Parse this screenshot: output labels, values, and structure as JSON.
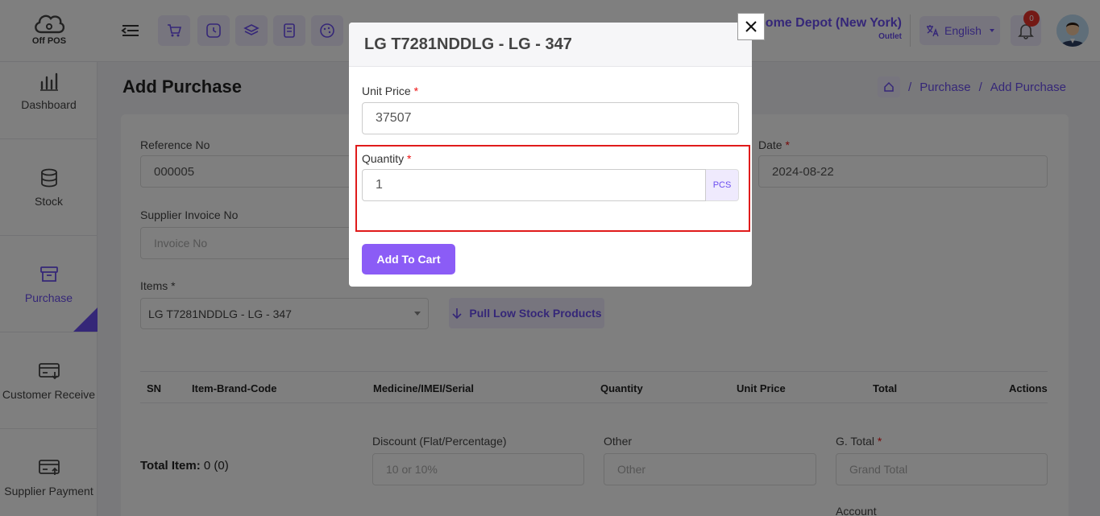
{
  "app": {
    "logo_text": "Off POS"
  },
  "header": {
    "outlet_name": "Home Depot (New York)",
    "outlet_sub": "Outlet",
    "language": "English",
    "notification_count": "0"
  },
  "sidebar": {
    "items": [
      {
        "label": "Dashboard",
        "icon": "bar-chart-icon"
      },
      {
        "label": "Stock",
        "icon": "database-icon"
      },
      {
        "label": "Purchase",
        "icon": "archive-box-icon"
      },
      {
        "label": "Customer Receive",
        "icon": "card-receive-icon"
      },
      {
        "label": "Supplier Payment",
        "icon": "card-pay-icon"
      }
    ]
  },
  "page": {
    "title": "Add Purchase",
    "breadcrumb": [
      "Purchase",
      "Add Purchase"
    ]
  },
  "form": {
    "reference_label": "Reference No",
    "reference_value": "000005",
    "date_label": "Date",
    "date_value": "2024-08-22",
    "supplier_invoice_label": "Supplier Invoice No",
    "supplier_invoice_placeholder": "Invoice No",
    "items_label": "Items *",
    "items_value": "LG T7281NDDLG - LG - 347",
    "pull_button": "Pull Low Stock Products",
    "table_headers": [
      "SN",
      "Item-Brand-Code",
      "Medicine/IMEI/Serial",
      "Quantity",
      "Unit Price",
      "Total",
      "Actions"
    ],
    "total_item_label": "Total Item:",
    "total_item_value": "0 (0)",
    "discount_label": "Discount (Flat/Percentage)",
    "discount_placeholder": "10 or 10%",
    "other_label": "Other",
    "other_placeholder": "Other",
    "gtotal_label": "G. Total",
    "gtotal_placeholder": "Grand Total",
    "account_label": "Account"
  },
  "modal": {
    "title": "LG T7281NDDLG - LG - 347",
    "unit_price_label": "Unit Price",
    "unit_price_value": "37507",
    "quantity_label": "Quantity",
    "quantity_value": "1",
    "unit": "PCS",
    "add_button": "Add To Cart"
  },
  "colors": {
    "accent": "#6b4ef0",
    "button": "#8b5cf6",
    "highlight": "#e01b1b",
    "badge": "#e8332a"
  }
}
